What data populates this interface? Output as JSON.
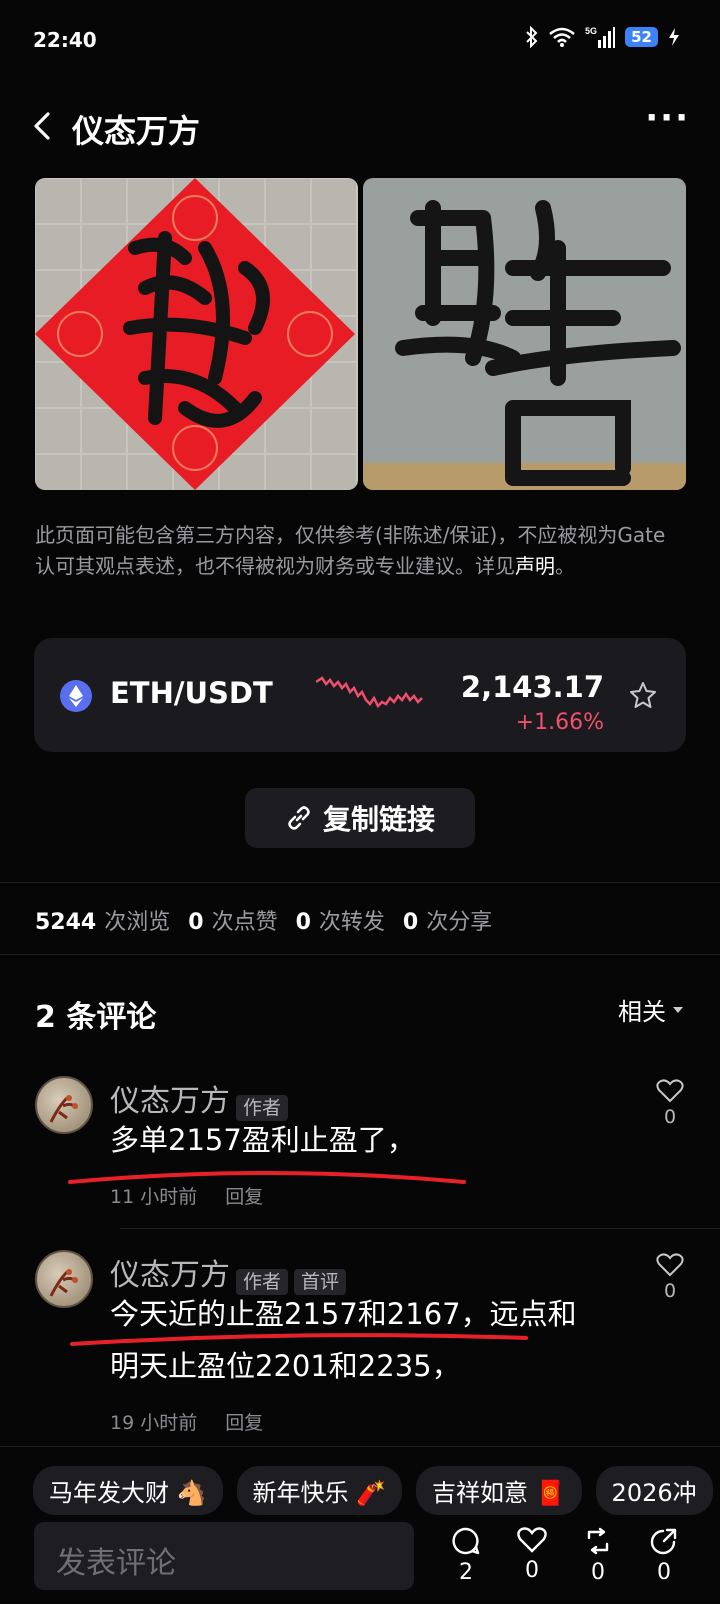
{
  "status": {
    "time": "22:40",
    "battery": "52",
    "network": "5G"
  },
  "header": {
    "title": "仪态万方"
  },
  "disclaimer": {
    "text": "此页面可能包含第三方内容，仅供参考(非陈述/保证)，不应被视为Gate认可其观点表述，也不得被视为财务或专业建议。详见",
    "link": "声明",
    "tail": "。"
  },
  "ticker": {
    "pair": "ETH/USDT",
    "price": "2,143.17",
    "change": "+1.66%",
    "change_color": "#f0506e"
  },
  "copy_link": {
    "label": "复制链接"
  },
  "stats": [
    {
      "num": "5244",
      "label": "次浏览"
    },
    {
      "num": "0",
      "label": "次点赞"
    },
    {
      "num": "0",
      "label": "次转发"
    },
    {
      "num": "0",
      "label": "次分享"
    }
  ],
  "comments_header": {
    "title": "2 条评论",
    "sort": "相关"
  },
  "comments": [
    {
      "name": "仪态万方",
      "badges": [
        "作者"
      ],
      "text": "多单2157盈利止盈了，",
      "time": "11 小时前",
      "reply": "回复",
      "likes": "0"
    },
    {
      "name": "仪态万方",
      "badges": [
        "作者",
        "首评"
      ],
      "text_line1": "今天近的止盈2157和2167，远点和",
      "text_line2": "明天止盈位2201和2235，",
      "time": "19 小时前",
      "reply": "回复",
      "likes": "0"
    }
  ],
  "tags": [
    "马年发大财 🐴",
    "新年快乐 🧨",
    "吉祥如意 🧧",
    "2026冲"
  ],
  "bottom": {
    "placeholder": "发表评论",
    "comments": "2",
    "likes": "0",
    "reposts": "0",
    "shares": "0"
  }
}
